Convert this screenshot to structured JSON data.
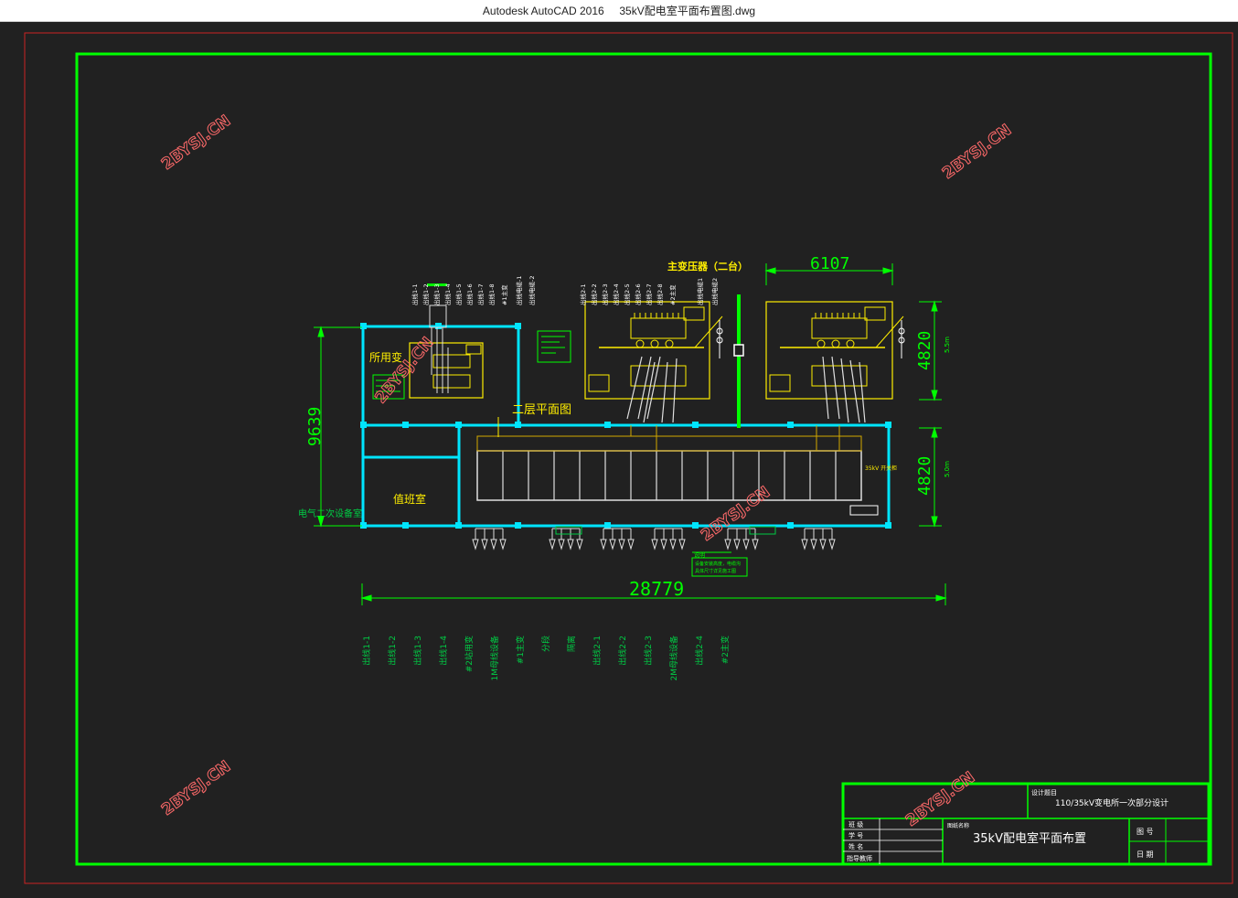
{
  "window": {
    "app_name": "Autodesk AutoCAD 2016",
    "file_name": "35kV配电室平面布置图.dwg"
  },
  "drawing": {
    "transformer_title": "主变压器（二台）",
    "station_transformer_label": "所用变",
    "duty_room_label": "值班室",
    "secondary_room_label": "电气二次设备室",
    "floor_plan_label": "二层平面图",
    "switchgear_label": "35kV 开关柜",
    "dimensions": {
      "total_length": "28779",
      "depth": "9639",
      "transformer_width": "6107",
      "transformer_depth": "4820",
      "room_depth": "4820"
    },
    "level_marks": {
      "top": "5.5m",
      "bottom": "5.0m"
    },
    "bottom_feeders": [
      "出线1-1",
      "出线1-2",
      "出线1-3",
      "出线1-4",
      "#2站用变",
      "1M母线设备",
      "#1主变",
      "分段",
      "隔离",
      "出线2-1",
      "出线2-2",
      "出线2-3",
      "2M母线设备",
      "出线2-4",
      "#2主变"
    ],
    "top_feeders": [
      "出线1-1",
      "出线1-2",
      "出线1-3",
      "出线1-4",
      "出线1-5",
      "出线1-6",
      "出线1-7",
      "出线1-8",
      "#1主变",
      "出线电缆-1",
      "出线电缆-2",
      "出线2-1",
      "出线2-2",
      "出线2-3",
      "出线2-4",
      "出线2-5",
      "出线2-6",
      "出线2-7",
      "出线2-8",
      "#2主变",
      "出线电缆1",
      "出线电缆2"
    ],
    "note_title": "说明",
    "note_text_1": "设备安装高度，电缆沟",
    "note_text_2": "具体尺寸详见施工图"
  },
  "title_block": {
    "project_label": "设计题目",
    "project_name": "110/35kV变电所一次部分设计",
    "drawing_label": "图纸名称",
    "drawing_name": "35kV配电室平面布置",
    "rows": [
      "班 级",
      "学 号",
      "姓 名",
      "指导教师"
    ],
    "fields": [
      "图 号",
      "日 期"
    ]
  },
  "watermarks": [
    "2BYSJ.CN",
    "2BYSJ.CN",
    "2BYSJ.CN",
    "2BYSJ.CN",
    "2BYSJ.CN",
    "2BYSJ.CN",
    "2BYSJ.CN"
  ],
  "colors": {
    "background": "#212121",
    "frame_green": "#00ff00",
    "outer_red": "#cc2222",
    "wall_cyan": "#00e5ff",
    "equipment_yellow": "#ffee00",
    "dim_green": "#00cc44",
    "cable_white": "#e0e0e0",
    "watermark": "#ff6a6a"
  }
}
